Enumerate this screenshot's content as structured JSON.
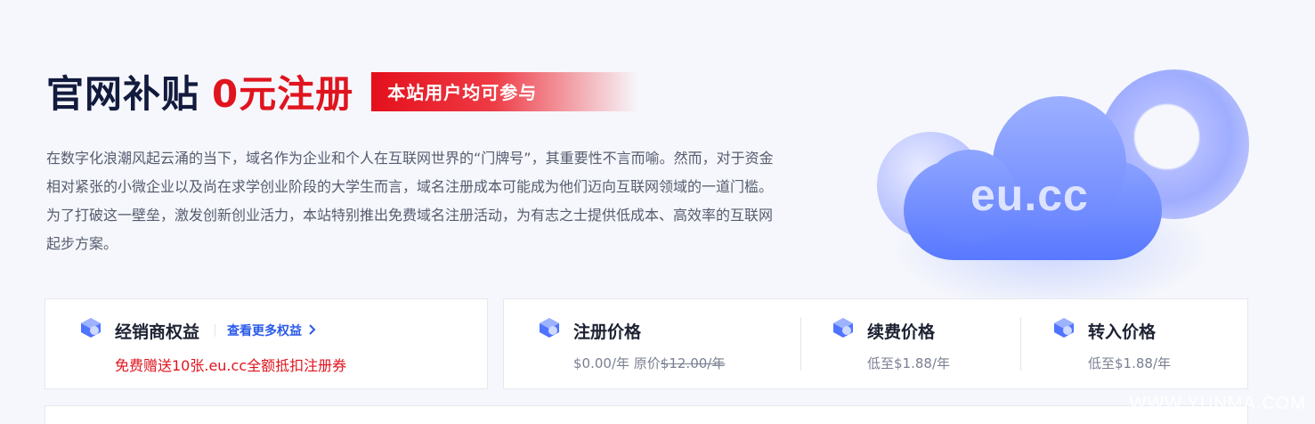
{
  "hero": {
    "title_main": "官网补贴",
    "title_accent": "0元注册",
    "tag": "本站用户均可参与",
    "intro": "在数字化浪潮风起云涌的当下，域名作为企业和个人在互联网世界的“门牌号”，其重要性不言而喻。然而，对于资金相对紧张的小微企业以及尚在求学创业阶段的大学生而言，域名注册成本可能成为他们迈向互联网领域的一道门槛。为了打破这一壁垒，激发创新创业活力，本站特别推出免费域名注册活动，为有志之士提供低成本、高效率的互联网起步方案。",
    "illustration_text": "eu.cc"
  },
  "dealer": {
    "title": "经销商权益",
    "more_link": "查看更多权益",
    "promo": "免费赠送10张.eu.cc全额抵扣注册券",
    "icon": "cube-badge-icon"
  },
  "pricing": [
    {
      "title": "注册价格",
      "price": "$0.00/年",
      "original_label": "原价",
      "original_price": "$12.00/年",
      "icon": "cube-badge-icon"
    },
    {
      "title": "续费价格",
      "price": "低至$1.88/年",
      "icon": "cube-badge-icon"
    },
    {
      "title": "转入价格",
      "price": "低至$1.88/年",
      "icon": "cube-badge-icon"
    }
  ],
  "watermark": "WWW.YUNMA.COM",
  "colors": {
    "accent_red": "#e0141e",
    "link_blue": "#2a5ae8",
    "cloud_blue": "#5878ff",
    "background": "#f6f7fc"
  }
}
